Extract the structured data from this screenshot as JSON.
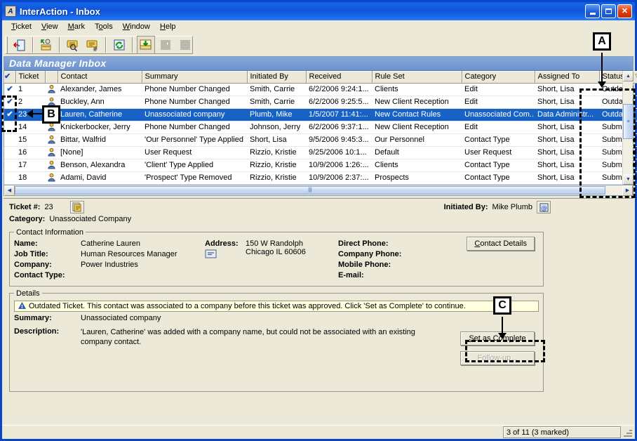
{
  "window": {
    "title": "InterAction - Inbox",
    "app_icon": "app-icon",
    "minimize": "minimize-button",
    "maximize": "maximize-button",
    "close": "close-button"
  },
  "menu": {
    "items": [
      "Ticket",
      "View",
      "Mark",
      "Tools",
      "Window",
      "Help"
    ]
  },
  "toolbar": {
    "buttons": [
      {
        "name": "exit-icon",
        "title": "Exit"
      },
      {
        "name": "assign-icon",
        "title": "Assign"
      },
      {
        "name": "view-ticket-icon",
        "title": "View Ticket"
      },
      {
        "name": "find-ticket-icon",
        "title": "Find Ticket"
      },
      {
        "name": "refresh-icon",
        "title": "Refresh"
      },
      {
        "name": "inbox-icon",
        "title": "Inbox"
      },
      {
        "name": "blank-icon-1",
        "title": ""
      },
      {
        "name": "blank-icon-2",
        "title": ""
      }
    ]
  },
  "grid": {
    "caption": "Data Manager Inbox",
    "columns": [
      "",
      "Ticket",
      "",
      "Contact",
      "Summary",
      "Initiated By",
      "Received",
      "Rule Set",
      "Category",
      "Assigned To",
      "Status"
    ],
    "sort_column": "Status",
    "sort_indicator": "descending",
    "rows": [
      {
        "marked": true,
        "selected": false,
        "ticket": "1",
        "contact": "Alexander, James",
        "summary": "Phone Number Changed",
        "initiated_by": "Smith, Carrie",
        "received": "6/2/2006 9:24:1...",
        "rule_set": "Clients",
        "category": "Edit",
        "assigned_to": "Short, Lisa",
        "status": "Outdated"
      },
      {
        "marked": true,
        "selected": false,
        "ticket": "2",
        "contact": "Buckley, Ann",
        "summary": "Phone Number Changed",
        "initiated_by": "Smith, Carrie",
        "received": "6/2/2006 9:25:5...",
        "rule_set": "New Client Reception",
        "category": "Edit",
        "assigned_to": "Short, Lisa",
        "status": "Outdated"
      },
      {
        "marked": true,
        "selected": true,
        "ticket": "23",
        "contact": "Lauren, Catherine",
        "summary": "Unassociated company",
        "initiated_by": "Plumb, Mike",
        "received": "1/5/2007 11:41:...",
        "rule_set": "New Contact Rules",
        "category": "Unassociated Com...",
        "assigned_to": "Data Administr...",
        "status": "Outdated"
      },
      {
        "marked": false,
        "selected": false,
        "ticket": "14",
        "contact": "Knickerbocker, Jerry",
        "summary": "Phone Number Changed",
        "initiated_by": "Johnson, Jerry",
        "received": "6/2/2006 9:37:1...",
        "rule_set": "New Client Reception",
        "category": "Edit",
        "assigned_to": "Short, Lisa",
        "status": "Submitted"
      },
      {
        "marked": false,
        "selected": false,
        "ticket": "15",
        "contact": "Bittar, Walfrid",
        "summary": "'Our Personnel' Type Applied",
        "initiated_by": "Short, Lisa",
        "received": "9/5/2006 9:45:3...",
        "rule_set": "Our Personnel",
        "category": "Contact Type",
        "assigned_to": "Short, Lisa",
        "status": "Submitted"
      },
      {
        "marked": false,
        "selected": false,
        "ticket": "16",
        "contact": "[None]",
        "summary": "User Request",
        "initiated_by": "Rizzio, Kristie",
        "received": "9/25/2006 10:1...",
        "rule_set": "Default",
        "category": "User Request",
        "assigned_to": "Short, Lisa",
        "status": "Submitted"
      },
      {
        "marked": false,
        "selected": false,
        "ticket": "17",
        "contact": "Benson, Alexandra",
        "summary": "'Client' Type Applied",
        "initiated_by": "Rizzio, Kristie",
        "received": "10/9/2006 1:26:...",
        "rule_set": "Clients",
        "category": "Contact Type",
        "assigned_to": "Short, Lisa",
        "status": "Submitted"
      },
      {
        "marked": false,
        "selected": false,
        "ticket": "18",
        "contact": "Adami, David",
        "summary": "'Prospect' Type Removed",
        "initiated_by": "Rizzio, Kristie",
        "received": "10/9/2006 2:37:...",
        "rule_set": "Prospects",
        "category": "Contact Type",
        "assigned_to": "Short, Lisa",
        "status": "Submitted"
      }
    ]
  },
  "detail": {
    "ticket_label": "Ticket #:",
    "ticket_value": "23",
    "category_label": "Category:",
    "category_value": "Unassociated Company",
    "initiated_by_label": "Initiated By:",
    "initiated_by_value": "Mike Plumb",
    "note_icon": "note-icon",
    "email_icon": "email-icon",
    "contact_information": {
      "legend": "Contact Information",
      "fields": [
        {
          "label": "Name:",
          "value": "Catherine Lauren"
        },
        {
          "label": "Job Title:",
          "value": "Human Resources Manager"
        },
        {
          "label": "Company:",
          "value": "Power Industries"
        },
        {
          "label": "Contact Type:",
          "value": ""
        }
      ],
      "address_label": "Address:",
      "address_lines": [
        "150 W Randolph",
        "Chicago IL 60606"
      ],
      "address_icon": "envelope-icon",
      "phone_fields": [
        {
          "label": "Direct Phone:",
          "value": ""
        },
        {
          "label": "Company Phone:",
          "value": ""
        },
        {
          "label": "Mobile Phone:",
          "value": ""
        },
        {
          "label": "E-mail:",
          "value": ""
        }
      ],
      "contact_details_button": "Contact Details"
    },
    "details": {
      "legend": "Details",
      "warning_icon": "warning-info-icon",
      "warning_text": "Outdated Ticket. This contact was associated to a company before this ticket was approved. Click 'Set as Complete' to continue.",
      "summary_label": "Summary:",
      "summary_value": "Unassociated company",
      "description_label": "Description:",
      "description_value": "'Lauren, Catherine' was added with a company name, but could not be associated with an existing company contact.",
      "set_as_complete_button": "Set as Complete",
      "follow_up_button": "Follow-up..."
    }
  },
  "statusbar": {
    "text": "3 of 11   (3 marked)"
  },
  "callouts": [
    {
      "id": "A",
      "label": "A"
    },
    {
      "id": "B",
      "label": "B"
    },
    {
      "id": "C",
      "label": "C"
    }
  ],
  "colors": {
    "titlebar": "#0f53d8",
    "selection": "#1862c6",
    "face": "#ece9d8",
    "caption_bar": "#7b9fd4",
    "warning_bg": "#ffffdd",
    "window_border": "#0a46c8"
  }
}
